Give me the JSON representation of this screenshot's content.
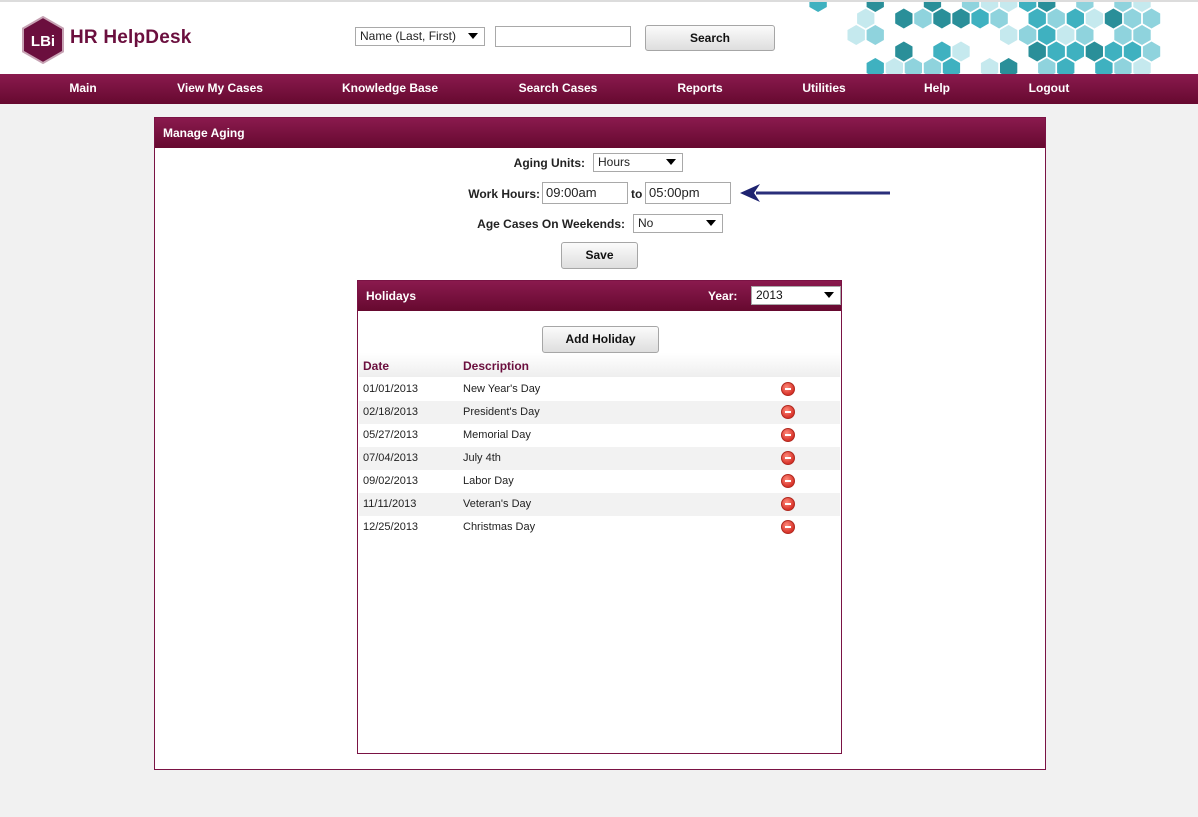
{
  "header": {
    "logo_badge": "LBi",
    "app_name": "HR HelpDesk",
    "search_by": "Name (Last, First)",
    "search_value": "",
    "search_button": "Search",
    "accent": "#6b0f3e",
    "hex_colors": [
      "#3fb1c0",
      "#8fd3dd",
      "#c5e9ee",
      "#2a8f99"
    ]
  },
  "nav": {
    "items": [
      {
        "label": "Main"
      },
      {
        "label": "View My Cases"
      },
      {
        "label": "Knowledge Base"
      },
      {
        "label": "Search Cases"
      },
      {
        "label": "Reports"
      },
      {
        "label": "Utilities"
      },
      {
        "label": "Help"
      },
      {
        "label": "Logout"
      }
    ]
  },
  "manage_aging": {
    "title": "Manage Aging",
    "aging_units_label": "Aging Units:",
    "aging_units_value": "Hours",
    "work_hours_label": "Work Hours:",
    "work_hours_start": "09:00am",
    "to_label": "to",
    "work_hours_end": "05:00pm",
    "weekends_label": "Age Cases On Weekends:",
    "weekends_value": "No",
    "save_button": "Save"
  },
  "holidays": {
    "title": "Holidays",
    "year_label": "Year:",
    "year_value": "2013",
    "add_button": "Add Holiday",
    "columns": {
      "date": "Date",
      "description": "Description"
    },
    "rows": [
      {
        "date": "01/01/2013",
        "description": "New Year's Day"
      },
      {
        "date": "02/18/2013",
        "description": "President's Day"
      },
      {
        "date": "05/27/2013",
        "description": "Memorial Day"
      },
      {
        "date": "07/04/2013",
        "description": "July 4th"
      },
      {
        "date": "09/02/2013",
        "description": "Labor Day"
      },
      {
        "date": "11/11/2013",
        "description": "Veteran's Day"
      },
      {
        "date": "12/25/2013",
        "description": "Christmas Day"
      }
    ]
  }
}
